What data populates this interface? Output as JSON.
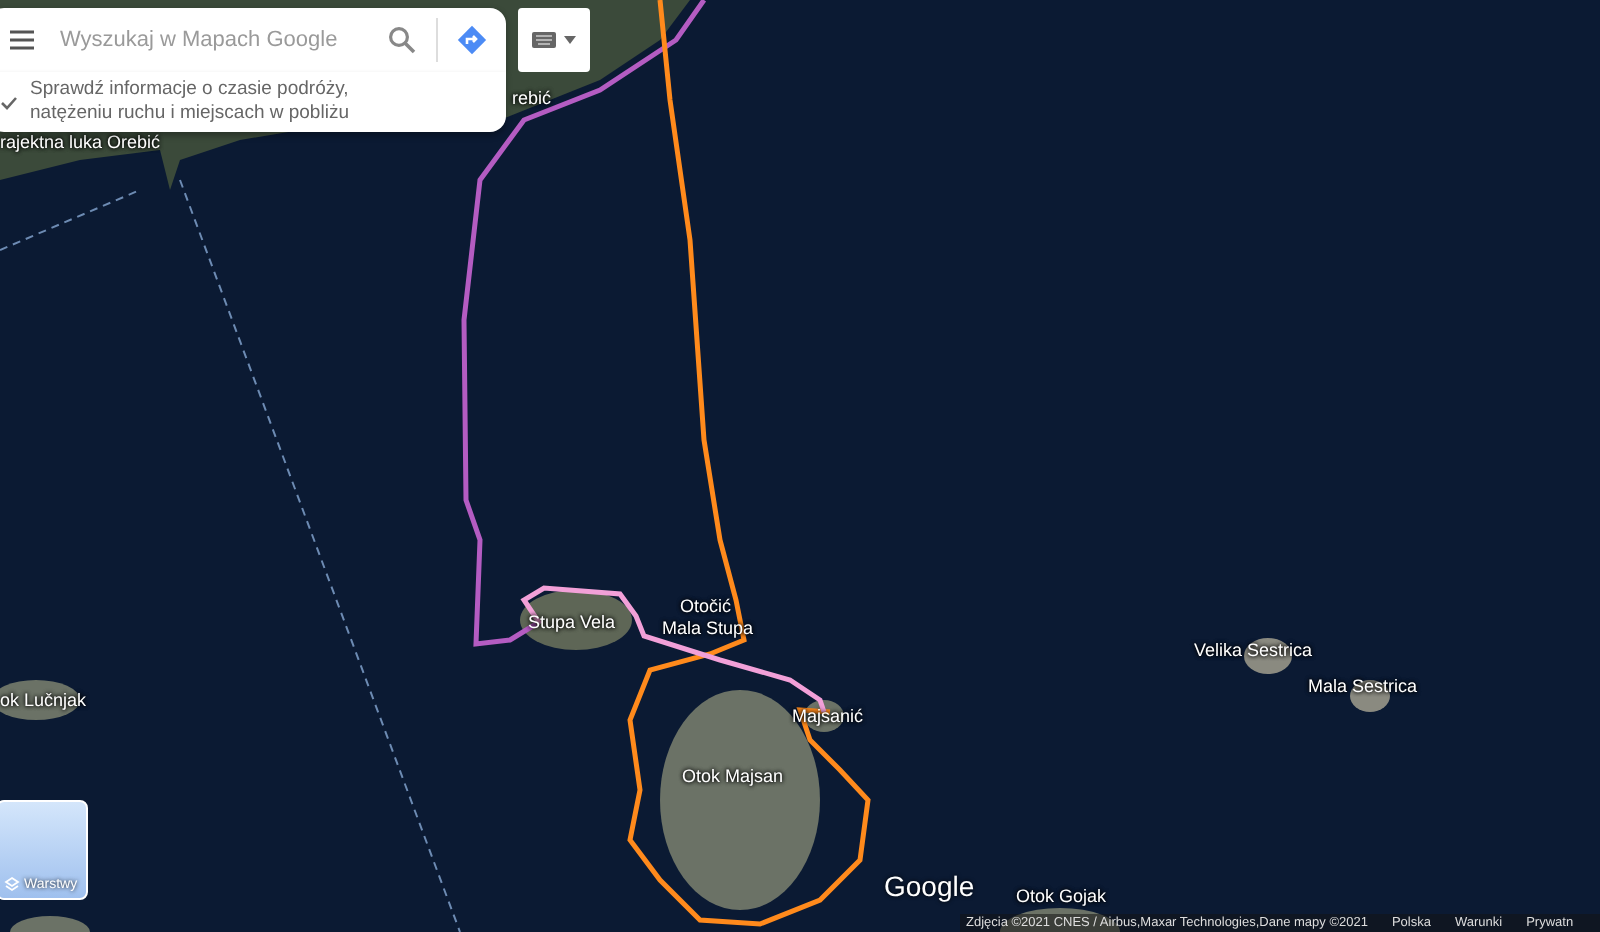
{
  "search": {
    "placeholder": "Wyszukaj w Mapach Google"
  },
  "hint": {
    "text": "Sprawdź informacje o czasie podróży, natężeniu ruchu i miejscach w pobliżu"
  },
  "map_labels": [
    {
      "text": "rebić"
    },
    {
      "text": "rajektna luka Orebić"
    },
    {
      "text": "Stupa Vela"
    },
    {
      "text": "Otočić"
    },
    {
      "text": "Mala Stupa"
    },
    {
      "text": "Majsanić"
    },
    {
      "text": "Otok Majsan"
    },
    {
      "text": "Velika Sestrica"
    },
    {
      "text": "Mala Sestrica"
    },
    {
      "text": "ok Lučnjak"
    },
    {
      "text": "Otok Gojak"
    }
  ],
  "layers": {
    "label": "Warstwy"
  },
  "logo": "Google",
  "footer": {
    "attribution": "Zdjęcia ©2021 CNES / Airbus,Maxar Technologies,Dane mapy ©2021",
    "links": [
      "Polska",
      "Warunki",
      "Prywatn"
    ]
  }
}
